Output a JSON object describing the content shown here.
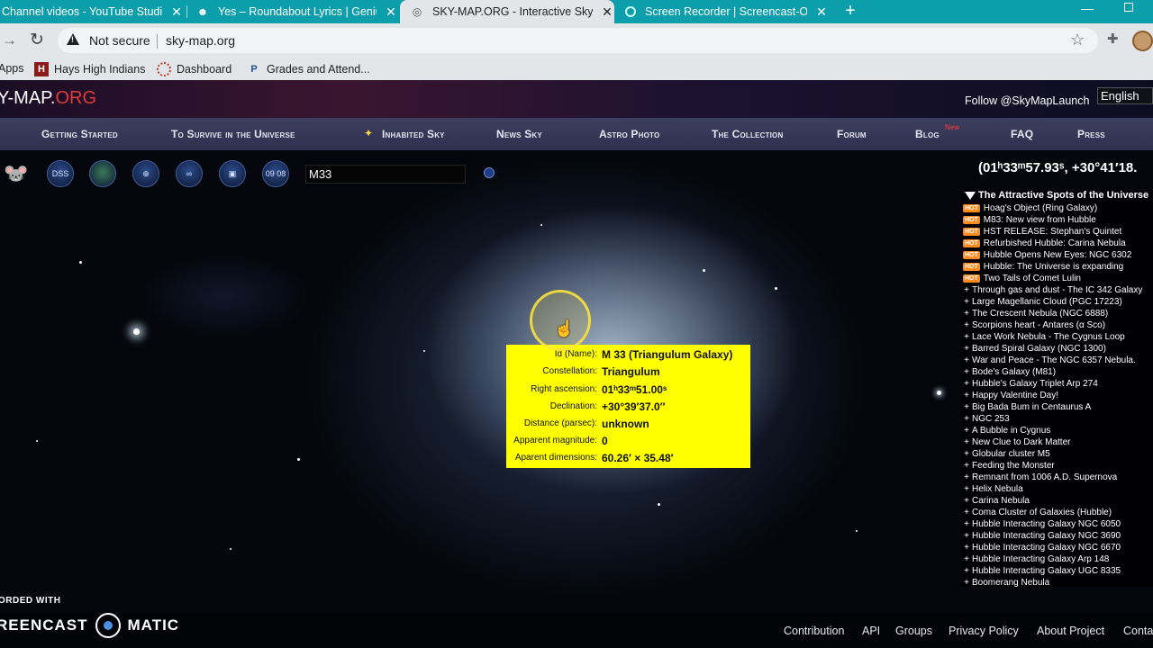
{
  "browser": {
    "tabs": [
      {
        "label": "Channel videos - YouTube Studio",
        "active": false
      },
      {
        "label": "Yes – Roundabout Lyrics | Genius",
        "active": false
      },
      {
        "label": "SKY-MAP.ORG - Interactive Sky M",
        "active": true
      },
      {
        "label": "Screen Recorder | Screencast-O",
        "active": false
      }
    ],
    "new_tab": "+",
    "security": "Not secure",
    "url": "sky-map.org",
    "bookmarks": [
      {
        "label": "Apps"
      },
      {
        "label": "Hays High Indians"
      },
      {
        "label": "Dashboard"
      },
      {
        "label": "Grades and Attend..."
      }
    ]
  },
  "site": {
    "logo_main": "Y-MAP.",
    "logo_org": "ORG",
    "follow": "Follow @SkyMapLaunch",
    "language": "English",
    "nav": [
      "Getting Started",
      "To Survive in the Universe",
      "Inhabited Sky",
      "News Sky",
      "Astro Photo",
      "The Collection",
      "Forum",
      "Blog",
      "FAQ",
      "Press"
    ],
    "blog_new": "New",
    "nav_news_dot": "●"
  },
  "toolbar": {
    "dss": "DSS",
    "time": "09 08",
    "search_value": "M33",
    "coords": "(01ʰ33ᵐ57.93ˢ, +30°41′18."
  },
  "spots": {
    "title": "The Attractive Spots of the Universe",
    "hot_label": "HOT",
    "items": [
      {
        "hot": true,
        "label": "Hoag's Object (Ring Galaxy)"
      },
      {
        "hot": true,
        "label": "M83: New view from Hubble"
      },
      {
        "hot": true,
        "label": "HST RELEASE: Stephan's Quintet"
      },
      {
        "hot": true,
        "label": "Refurbished Hubble: Carina Nebula"
      },
      {
        "hot": true,
        "label": "Hubble Opens New Eyes: NGC 6302"
      },
      {
        "hot": true,
        "label": "Hubble: The Universe is expanding"
      },
      {
        "hot": true,
        "label": "Two Tails of Comet Lulin"
      },
      {
        "hot": false,
        "label": "Through gas and dust - The IC 342 Galaxy"
      },
      {
        "hot": false,
        "label": "Large Magellanic Cloud (PGC 17223)"
      },
      {
        "hot": false,
        "label": "The Crescent Nebula (NGC 6888)"
      },
      {
        "hot": false,
        "label": "Scorpions heart - Antares (α Sco)"
      },
      {
        "hot": false,
        "label": "Lace Work Nebula - The Cygnus Loop"
      },
      {
        "hot": false,
        "label": "Barred Spiral Galaxy (NGC 1300)"
      },
      {
        "hot": false,
        "label": "War and Peace - The NGC 6357 Nebula."
      },
      {
        "hot": false,
        "label": "Bode's Galaxy (M81)"
      },
      {
        "hot": false,
        "label": "Hubble's Galaxy Triplet Arp 274"
      },
      {
        "hot": false,
        "label": "Happy Valentine Day!"
      },
      {
        "hot": false,
        "label": "Big Bada Bum in Centaurus A"
      },
      {
        "hot": false,
        "label": "NGC 253"
      },
      {
        "hot": false,
        "label": "A Bubble in Cygnus"
      },
      {
        "hot": false,
        "label": "New Clue to Dark Matter"
      },
      {
        "hot": false,
        "label": "Globular cluster M5"
      },
      {
        "hot": false,
        "label": "Feeding the Monster"
      },
      {
        "hot": false,
        "label": "Remnant from 1006 A.D. Supernova"
      },
      {
        "hot": false,
        "label": "Helix Nebula"
      },
      {
        "hot": false,
        "label": "Carina Nebula"
      },
      {
        "hot": false,
        "label": "Coma Cluster of Galaxies (Hubble)"
      },
      {
        "hot": false,
        "label": "Hubble Interacting Galaxy NGC 6050"
      },
      {
        "hot": false,
        "label": "Hubble Interacting Galaxy NGC 3690"
      },
      {
        "hot": false,
        "label": "Hubble Interacting Galaxy NGC 6670"
      },
      {
        "hot": false,
        "label": "Hubble Interacting Galaxy Arp 148"
      },
      {
        "hot": false,
        "label": "Hubble Interacting Galaxy UGC 8335"
      },
      {
        "hot": false,
        "label": "Boomerang Nebula"
      }
    ]
  },
  "info": {
    "rows": [
      {
        "label": "Id (Name):",
        "value": "M 33 (Triangulum Galaxy)",
        "bold": true
      },
      {
        "label": "Constellation:",
        "value": "Triangulum",
        "bold": true
      },
      {
        "label": "Right ascension:",
        "value": "01ʰ33ᵐ51.00ˢ",
        "bold": true
      },
      {
        "label": "Declination:",
        "value": "+30°39′37.0″",
        "bold": true
      },
      {
        "label": "Distance (parsec):",
        "value": "unknown",
        "bold": true
      },
      {
        "label": "Apparent magnitude:",
        "value": "0",
        "bold": true
      },
      {
        "label": "Aparent dimensions:",
        "value": "60.26′ × 35.48′",
        "bold": true
      }
    ]
  },
  "watermark": {
    "recorded_with": "ORDED WITH",
    "brand_left": "REENCAST",
    "brand_right": "MATIC"
  },
  "footer": {
    "links": [
      "Contribution",
      "API",
      "Groups",
      "Privacy Policy",
      "About Project",
      "Conta"
    ]
  },
  "colors": {
    "tabbar": "#0d9eab",
    "popup": "#ffff00",
    "hot_badge": "#ff8a1e",
    "logo_org": "#e23a3a"
  }
}
